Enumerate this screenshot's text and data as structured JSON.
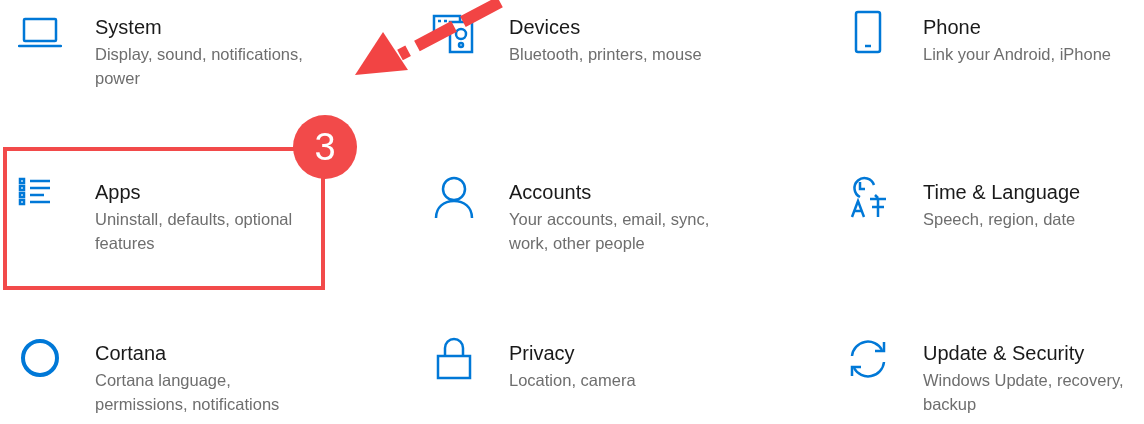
{
  "categories": [
    {
      "title": "System",
      "subtitle": "Display, sound, notifications, power",
      "highlighted": false
    },
    {
      "title": "Devices",
      "subtitle": "Bluetooth, printers, mouse",
      "highlighted": false
    },
    {
      "title": "Phone",
      "subtitle": "Link your Android, iPhone",
      "highlighted": false
    },
    {
      "title": "Apps",
      "subtitle": "Uninstall, defaults, optional features",
      "highlighted": true,
      "step_badge": "3"
    },
    {
      "title": "Accounts",
      "subtitle": "Your accounts, email, sync, work, other people",
      "highlighted": false
    },
    {
      "title": "Time & Language",
      "subtitle": "Speech, region, date",
      "highlighted": false
    },
    {
      "title": "Cortana",
      "subtitle": "Cortana language, permissions, notifications",
      "highlighted": false
    },
    {
      "title": "Privacy",
      "subtitle": "Location, camera",
      "highlighted": false
    },
    {
      "title": "Update & Security",
      "subtitle": "Windows Update, recovery, backup",
      "highlighted": false
    }
  ]
}
